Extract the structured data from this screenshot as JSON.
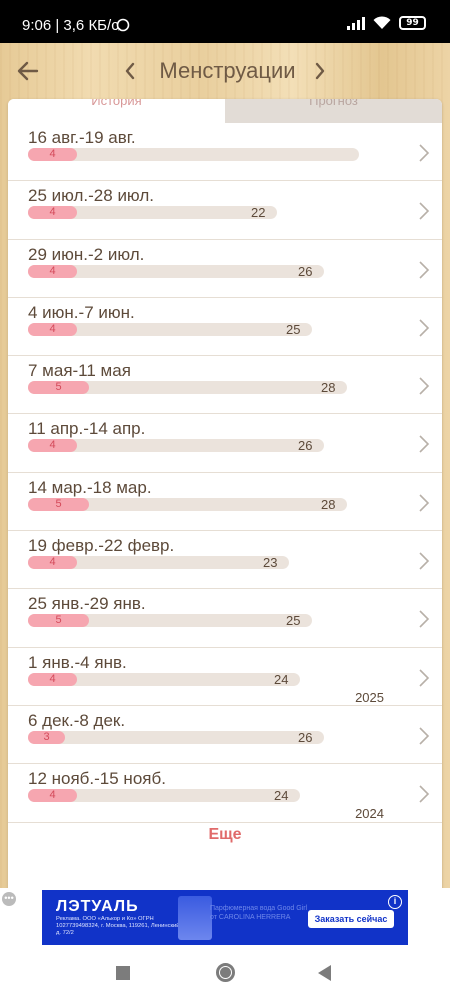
{
  "status_bar": {
    "time_network": "9:06 | 3,6 КБ/с",
    "battery": "99",
    "icons": [
      "whatsapp-icon",
      "signal-icon",
      "wifi-icon",
      "battery-icon"
    ]
  },
  "header": {
    "title": "Менструации",
    "icons": [
      "back-arrow-icon",
      "chevron-left-icon",
      "chevron-right-icon"
    ]
  },
  "tabs": [
    {
      "label": "История",
      "active": true
    },
    {
      "label": "Прогноз",
      "active": false
    }
  ],
  "periods": [
    {
      "dates": "16 авг.-19 авг.",
      "period_days": "4",
      "cycle_days": "",
      "year": ""
    },
    {
      "dates": "25 июл.-28 июл.",
      "period_days": "4",
      "cycle_days": "22",
      "year": ""
    },
    {
      "dates": "29 июн.-2 июл.",
      "period_days": "4",
      "cycle_days": "26",
      "year": ""
    },
    {
      "dates": "4 июн.-7 июн.",
      "period_days": "4",
      "cycle_days": "25",
      "year": ""
    },
    {
      "dates": "7 мая-11 мая",
      "period_days": "5",
      "cycle_days": "28",
      "year": ""
    },
    {
      "dates": "11 апр.-14 апр.",
      "period_days": "4",
      "cycle_days": "26",
      "year": ""
    },
    {
      "dates": "14 мар.-18 мар.",
      "period_days": "5",
      "cycle_days": "28",
      "year": ""
    },
    {
      "dates": "19 февр.-22 февр.",
      "period_days": "4",
      "cycle_days": "23",
      "year": ""
    },
    {
      "dates": "25 янв.-29 янв.",
      "period_days": "5",
      "cycle_days": "25",
      "year": ""
    },
    {
      "dates": "1 янв.-4 янв.",
      "period_days": "4",
      "cycle_days": "24",
      "year": "2025"
    },
    {
      "dates": "6 дек.-8 дек.",
      "period_days": "3",
      "cycle_days": "26",
      "year": ""
    },
    {
      "dates": "12 нояб.-15 нояб.",
      "period_days": "4",
      "cycle_days": "24",
      "year": "2024"
    }
  ],
  "more_label": "Еще",
  "ad": {
    "brand": "ЛЭТУАЛЬ",
    "legal": "Реклама. ООО «Алькор и Ко» ОГРН 1027739498324, г. Москва, 119261, Ленинский пр., д. 72/2",
    "text": "Парфюмерная вода Good Girl от CAROLINA HERRERA",
    "cta": "Заказать сейчас",
    "info_icon": "i"
  },
  "colors": {
    "accent_pink": "#f6a6b0",
    "period_number": "#d44a5a",
    "more_red": "#e06a6a",
    "text_brown": "#5d4a3a",
    "ad_blue": "#1133c8"
  }
}
